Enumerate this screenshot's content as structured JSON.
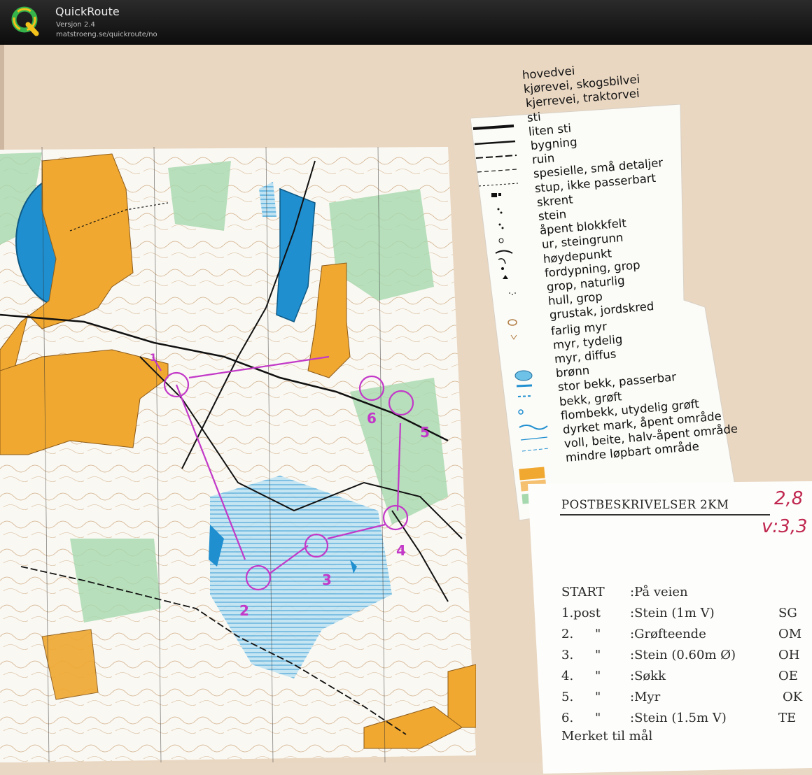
{
  "app": {
    "title": "QuickRoute",
    "version": "Versjon 2.4",
    "url": "matstroeng.se/quickroute/no"
  },
  "legend": {
    "items": [
      {
        "label": "hovedvei",
        "symbol": "road-main"
      },
      {
        "label": "kjørevei, skogsbilvei",
        "symbol": "road-car"
      },
      {
        "label": "kjerrevei, traktorvei",
        "symbol": "road-cart"
      },
      {
        "label": "sti",
        "symbol": "path"
      },
      {
        "label": "liten sti",
        "symbol": "path-small"
      },
      {
        "label": "bygning",
        "symbol": "building"
      },
      {
        "label": "ruin",
        "symbol": "ruin"
      },
      {
        "label": "spesielle, små detaljer",
        "symbol": "special"
      },
      {
        "label": "stup, ikke passerbart",
        "symbol": "cliff"
      },
      {
        "label": "skrent",
        "symbol": "rock-face"
      },
      {
        "label": "stein",
        "symbol": "boulder"
      },
      {
        "label": "åpent blokkfelt",
        "symbol": "boulder-field"
      },
      {
        "label": "ur, steingrunn",
        "symbol": "stony-ground"
      },
      {
        "label": "høydepunkt",
        "symbol": "knoll"
      },
      {
        "label": "fordypning, grop",
        "symbol": "depression"
      },
      {
        "label": "grop, naturlig",
        "symbol": "pit"
      },
      {
        "label": "hull, grop",
        "symbol": "hole"
      },
      {
        "label": "grustak, jordskred",
        "symbol": "gravel-pit"
      },
      {
        "label": "farlig myr",
        "symbol": "marsh-dangerous"
      },
      {
        "label": "myr, tydelig",
        "symbol": "marsh"
      },
      {
        "label": "myr, diffus",
        "symbol": "marsh-indistinct"
      },
      {
        "label": "brønn",
        "symbol": "well"
      },
      {
        "label": "stor bekk, passerbar",
        "symbol": "stream-large"
      },
      {
        "label": "bekk, grøft",
        "symbol": "stream"
      },
      {
        "label": "flombekk, utydelig grøft",
        "symbol": "stream-seasonal"
      },
      {
        "label": "dyrket mark, åpent område",
        "symbol": "cultivated"
      },
      {
        "label": "voll, beite, halv-åpent område",
        "symbol": "semi-open"
      },
      {
        "label": "mindre løpbart område",
        "symbol": "slow-run"
      }
    ]
  },
  "control_descriptions": {
    "title": "POSTBESKRIVELSER 2KM",
    "rows": [
      {
        "num": "START",
        "quote": "",
        "desc": ":På veien",
        "code": ""
      },
      {
        "num": "1.post",
        "quote": "",
        "desc": ":Stein (1m V)",
        "code": "SG"
      },
      {
        "num": "2.",
        "quote": "\"",
        "desc": ":Grøfteende",
        "code": "OM"
      },
      {
        "num": "3.",
        "quote": "\"",
        "desc": ":Stein (0.60m Ø)",
        "code": "OH"
      },
      {
        "num": "4.",
        "quote": "\"",
        "desc": ":Søkk",
        "code": "OE"
      },
      {
        "num": "5.",
        "quote": "\"",
        "desc": ":Myr",
        "code": "OK"
      },
      {
        "num": "6.",
        "quote": "\"",
        "desc": ":Stein (1.5m V)",
        "code": "TE"
      }
    ],
    "footer": "Merket til mål",
    "handwritten_distance": "2,8",
    "handwritten_v": "v:3,3"
  },
  "course": {
    "color": "#c238c8",
    "start_label": "1",
    "control_labels": [
      "2",
      "3",
      "4",
      "5",
      "6"
    ]
  },
  "colors": {
    "open_land": "#f0a830",
    "water": "#1f8fd0",
    "marsh": "#5cb8e0",
    "vegetation": "#8fcf9a",
    "contour": "#b07a40",
    "course": "#c238c8",
    "paper": "#faf8f2",
    "background": "#e9d7c2"
  }
}
